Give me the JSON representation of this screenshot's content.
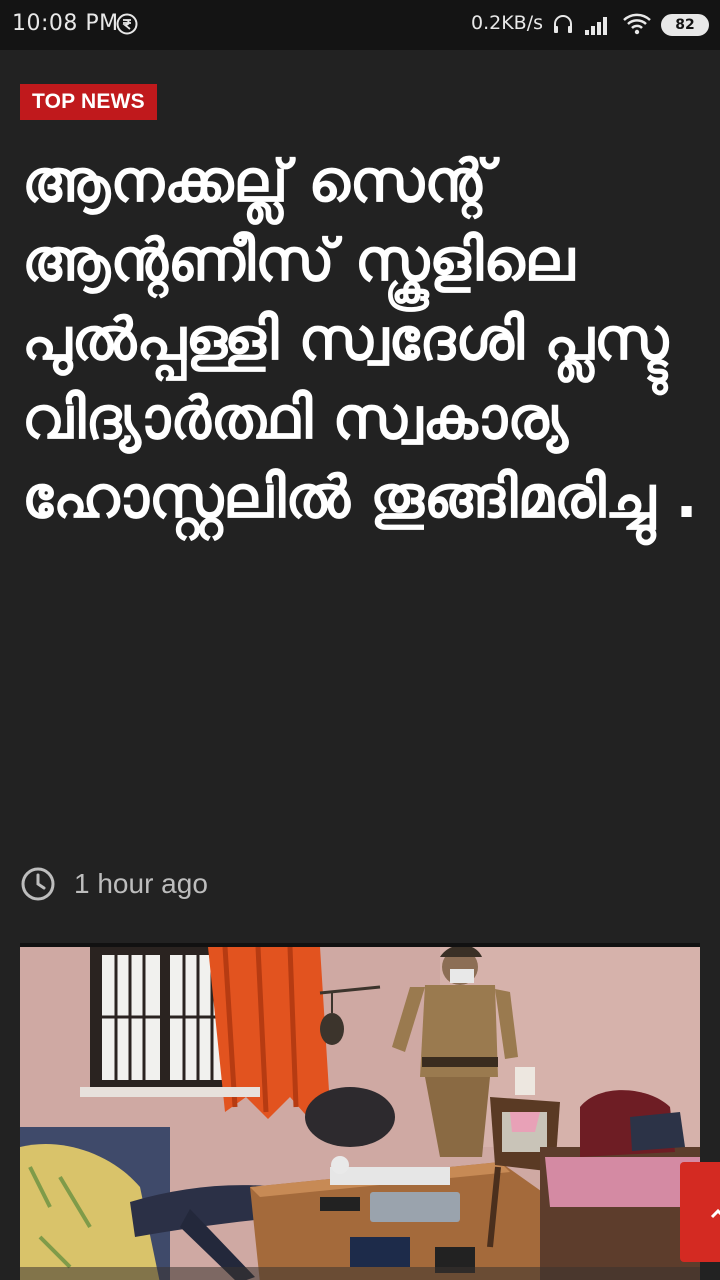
{
  "status_bar": {
    "time": "10:08 PM",
    "app_icon": "rupee-badge-icon",
    "network_speed": "0.2KB/s",
    "battery": "82",
    "icons": [
      "headset-icon",
      "signal-icon",
      "wifi-icon",
      "battery-icon"
    ]
  },
  "article": {
    "category": "TOP NEWS",
    "headline": "ആനക്കല്ല് സെന്റ് ആന്റണീസ് സ്കൂളിലെ പുൽപ്പള്ളി സ്വദേശി പ്ലസ്ടു വിദ്യാർത്ഥി സ്വകാര്യ ഹോസ്റ്റലിൽ തൂങ്ങിമരിച്ചു .",
    "time_ago": "1 hour ago",
    "time_icon": "clock-icon",
    "image": "news-photo"
  },
  "floating_button": {
    "icon": "chevron-up-icon"
  },
  "colors": {
    "background": "#222222",
    "status_bar": "#141414",
    "badge": "#c0191c",
    "headline_text": "#ffffff",
    "meta_text": "#bdbdbd",
    "fab": "#d42a22"
  }
}
